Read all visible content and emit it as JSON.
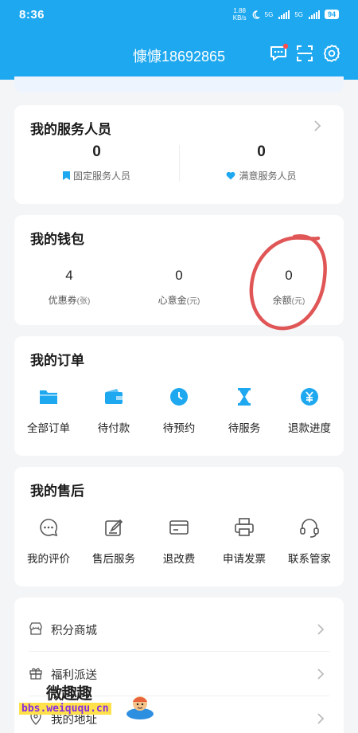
{
  "status_bar": {
    "time": "8:36",
    "net_speed_value": "1.88",
    "net_speed_unit": "KB/s",
    "signal_label_1": "5G",
    "signal_label_2": "5G",
    "battery": "94"
  },
  "header": {
    "title": "慷慷18692865",
    "icons": [
      "message-icon",
      "scan-icon",
      "settings-icon"
    ],
    "bg_color": "#1ea8f0"
  },
  "service_staff": {
    "title": "我的服务人员",
    "stats": [
      {
        "value": "0",
        "label": "固定服务人员",
        "icon": "bookmark-icon",
        "icon_color": "#1ea8f0"
      },
      {
        "value": "0",
        "label": "满意服务人员",
        "icon": "heart-icon",
        "icon_color": "#1ea8f0"
      }
    ]
  },
  "wallet": {
    "title": "我的钱包",
    "items": [
      {
        "value": "4",
        "label": "优惠券",
        "unit": "(张)"
      },
      {
        "value": "0",
        "label": "心意金",
        "unit": "(元)"
      },
      {
        "value": "0",
        "label": "余额",
        "unit": "(元)"
      }
    ],
    "annotation_color": "#e05555"
  },
  "orders": {
    "title": "我的订单",
    "items": [
      {
        "label": "全部订单",
        "icon": "folder-icon"
      },
      {
        "label": "待付款",
        "icon": "wallet-icon"
      },
      {
        "label": "待预约",
        "icon": "clock-icon"
      },
      {
        "label": "待服务",
        "icon": "hourglass-icon"
      },
      {
        "label": "退款进度",
        "icon": "yen-icon"
      }
    ]
  },
  "after_sales": {
    "title": "我的售后",
    "items": [
      {
        "label": "我的评价",
        "icon": "chat-icon"
      },
      {
        "label": "售后服务",
        "icon": "edit-icon"
      },
      {
        "label": "退改费",
        "icon": "card-icon"
      },
      {
        "label": "申请发票",
        "icon": "printer-icon"
      },
      {
        "label": "联系管家",
        "icon": "headset-icon"
      }
    ]
  },
  "menu": {
    "items": [
      {
        "label": "积分商城",
        "icon": "shop-icon"
      },
      {
        "label": "福利派送",
        "icon": "gift-icon"
      },
      {
        "label": "我的地址",
        "icon": "location-icon"
      }
    ]
  },
  "watermark": {
    "title": "微趣趣",
    "url": "bbs.weiququ.cn"
  },
  "colors": {
    "accent": "#1ea8f0",
    "background": "#f4f5f7",
    "annotation": "#e05555"
  }
}
